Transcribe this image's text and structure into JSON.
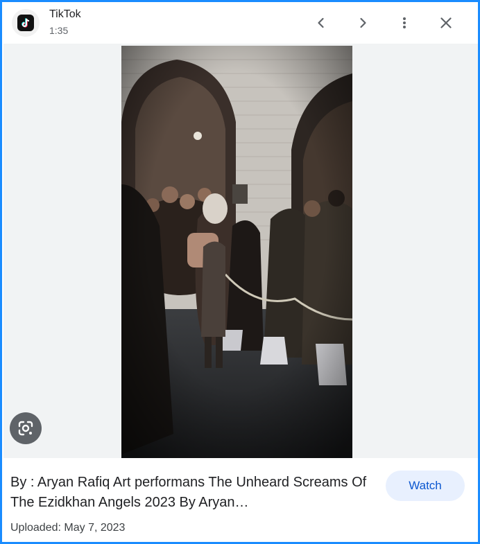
{
  "header": {
    "app_name": "TikTok",
    "duration": "1:35",
    "prev_icon": "chevron-left-icon",
    "next_icon": "chevron-right-icon",
    "more_icon": "more-vert-icon",
    "close_icon": "close-icon"
  },
  "media": {
    "lens_icon": "google-lens-icon"
  },
  "footer": {
    "title": "By : Aryan Rafiq Art performans The Unheard Screams Of The Ezidkhan Angels 2023 By Aryan…",
    "uploaded": "Uploaded: May 7, 2023",
    "watch_label": "Watch"
  },
  "colors": {
    "border": "#1a8cff",
    "watch_bg": "#e8f0fe",
    "watch_text": "#0b57d0",
    "media_bg": "#f1f3f4"
  }
}
